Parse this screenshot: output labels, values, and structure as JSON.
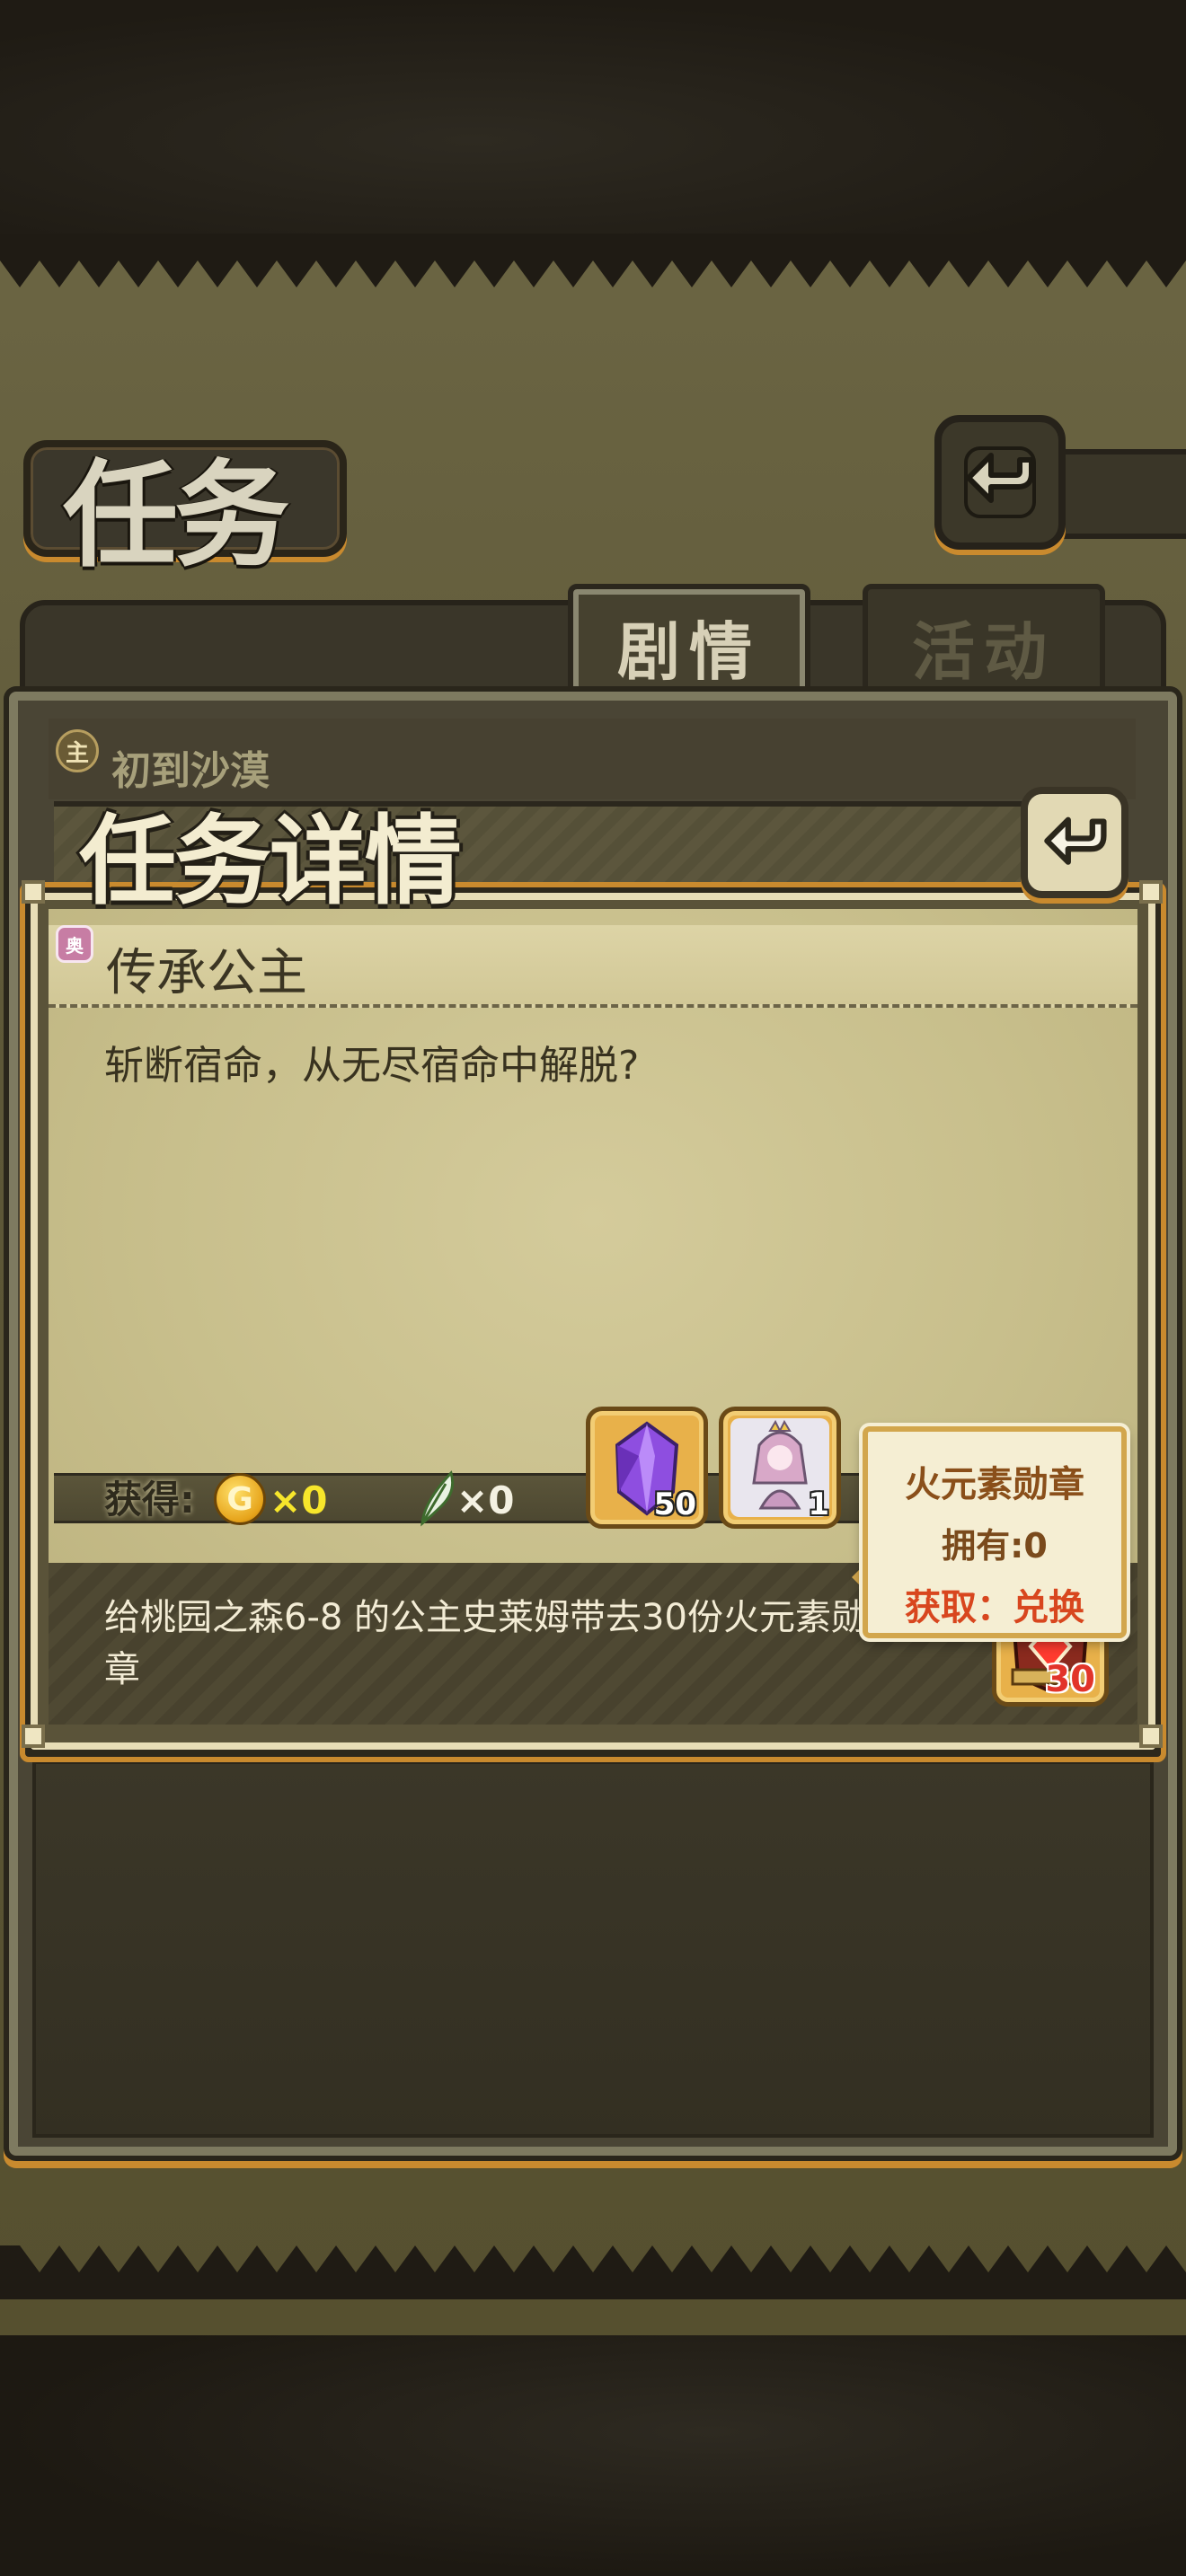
{
  "header": {
    "title": "任务",
    "back_icon": "back-arrow-icon"
  },
  "tabs": [
    {
      "label": "剧情",
      "active": true
    },
    {
      "label": "活动",
      "active": false
    }
  ],
  "quest_list": {
    "badge": "主",
    "first_item_title": "初到沙漠"
  },
  "detail": {
    "title": "任务详情",
    "close_icon": "back-arrow-icon",
    "quest_badge": "奥",
    "quest_name": "传承公主",
    "description": "斩断宿命，从无尽宿命中解脱?",
    "rewards": {
      "label": "获得:",
      "gold": "×0",
      "feather": "×0",
      "items": [
        {
          "icon": "purple-crystal-icon",
          "count": "50"
        },
        {
          "icon": "princess-figure-icon",
          "count": "1"
        }
      ]
    },
    "objective": "给桃园之森6-8 的公主史莱姆带去30份火元素勋章",
    "required_item": {
      "icon": "fire-medal-icon",
      "count": "30"
    }
  },
  "tooltip": {
    "title": "火元素勋章",
    "owned": "拥有:0",
    "get": "获取：兑换"
  },
  "colors": {
    "accent_orange": "#c98a2e",
    "parchment": "#c8bf8c",
    "gold_text": "#f7e62b",
    "tooltip_link": "#d8461e"
  }
}
